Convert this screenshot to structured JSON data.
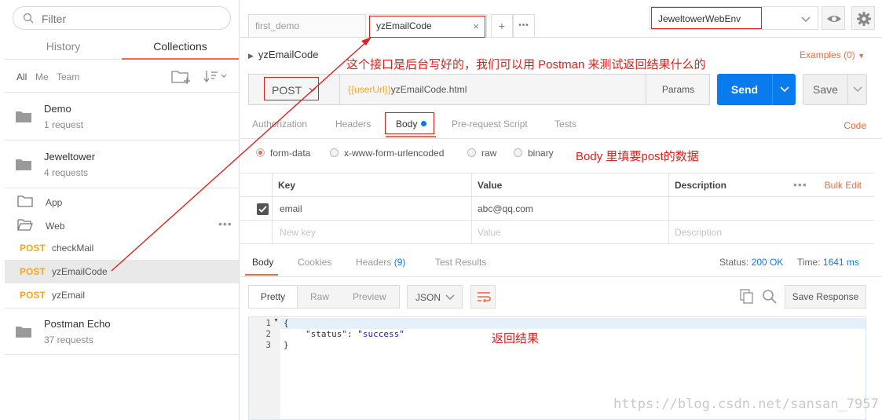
{
  "sidebar": {
    "filter_placeholder": "Filter",
    "tabs": [
      "History",
      "Collections"
    ],
    "filter_options": [
      "All",
      "Me",
      "Team"
    ],
    "collections": [
      {
        "name": "Demo",
        "count": "1 request"
      },
      {
        "name": "Jeweltower",
        "count": "4 requests"
      }
    ],
    "folders": [
      {
        "name": "App"
      },
      {
        "name": "Web"
      }
    ],
    "requests": [
      {
        "method": "POST",
        "name": "checkMail"
      },
      {
        "method": "POST",
        "name": "yzEmailCode"
      },
      {
        "method": "POST",
        "name": "yzEmail"
      }
    ],
    "last_collection": {
      "name": "Postman Echo",
      "count": "37 requests"
    }
  },
  "tabs": {
    "items": [
      {
        "label": "first_demo"
      },
      {
        "label": "yzEmailCode",
        "close": "×"
      }
    ],
    "add": "+",
    "more": "•••"
  },
  "environment": {
    "selected": "JeweltowerWebEnv"
  },
  "request": {
    "name": "yzEmailCode",
    "examples": "Examples (0)",
    "method": "POST",
    "url_variable": "{{userUrl}}",
    "url_path": "yzEmailCode.html",
    "params_label": "Params",
    "send_label": "Send",
    "save_label": "Save"
  },
  "request_tabs": [
    "Authorization",
    "Headers",
    "Body",
    "Pre-request Script",
    "Tests"
  ],
  "code_link": "Code",
  "body_modes": [
    "form-data",
    "x-www-form-urlencoded",
    "raw",
    "binary"
  ],
  "form_table": {
    "headers": [
      "Key",
      "Value",
      "Description"
    ],
    "bulk_edit": "Bulk Edit",
    "more": "•••",
    "rows": [
      {
        "key": "email",
        "value": "abc@qq.com",
        "description": ""
      }
    ],
    "placeholders": {
      "key": "New key",
      "value": "Value",
      "description": "Description"
    }
  },
  "response_tabs": {
    "body": "Body",
    "cookies": "Cookies",
    "headers": "Headers",
    "headers_count": "(9)",
    "test_results": "Test Results"
  },
  "status": {
    "label": "Status:",
    "value": "200 OK",
    "time_label": "Time:",
    "time_value": "1641 ms"
  },
  "response_toolbar": {
    "views": [
      "Pretty",
      "Raw",
      "Preview"
    ],
    "format": "JSON",
    "save_response": "Save Response"
  },
  "response_body": {
    "line_numbers": [
      "1",
      "2",
      "3"
    ],
    "lines": {
      "open": "{",
      "key": "\"status\"",
      "colon": ": ",
      "value": "\"success\"",
      "close": "}"
    }
  },
  "annotations": {
    "top": "这个接口是后台写好的，我们可以用 Postman 来测试返回结果什么的",
    "body": "Body 里填要post的数据",
    "result": "返回结果"
  },
  "watermark": "https://blog.csdn.net/sansan_7957",
  "colors": {
    "accent": "#f26b3a",
    "send": "#097bed",
    "post_method": "#f5a623",
    "annotation": "#e0201c"
  }
}
